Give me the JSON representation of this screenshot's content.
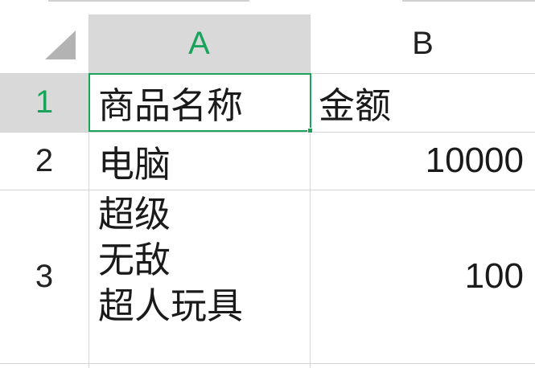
{
  "spreadsheet": {
    "columns": [
      {
        "label": "A",
        "selected": true
      },
      {
        "label": "B",
        "selected": false
      }
    ],
    "rows": [
      {
        "label": "1",
        "selected": true
      },
      {
        "label": "2",
        "selected": false
      },
      {
        "label": "3",
        "selected": false
      }
    ],
    "cells": {
      "A1": "商品名称",
      "B1": "金额",
      "A2": "电脑",
      "B2": "10000",
      "A3_lines": [
        "超级",
        "无敌",
        "超人玩具"
      ],
      "B3": "100"
    },
    "active_cell": "A1",
    "colors": {
      "accent": "#1aa35a",
      "header_selected_bg": "#d9d9d9",
      "gridline": "#d4d4d4"
    }
  }
}
